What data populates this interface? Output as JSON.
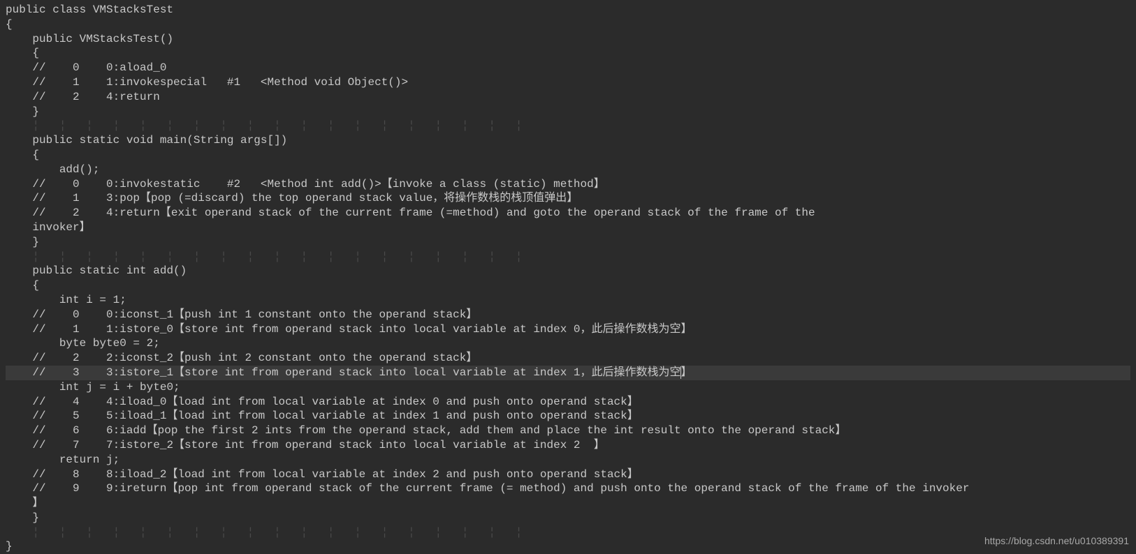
{
  "watermark": "https://blog.csdn.net/u010389391",
  "whitespace_guide": "    ¦   ¦   ¦   ¦   ¦   ¦   ¦   ¦   ¦   ¦   ¦   ¦   ¦   ¦   ¦   ¦   ¦   ¦   ¦",
  "code": {
    "line01": "public class VMStacksTest",
    "line02": "{",
    "line03": "    public VMStacksTest()",
    "line04": "    {",
    "line05": "    //    0    0:aload_0",
    "line06": "    //    1    1:invokespecial   #1   <Method void Object()>",
    "line07": "    //    2    4:return",
    "line08": "    }",
    "line10": "    public static void main(String args[])",
    "line11": "    {",
    "line12": "        add();",
    "line13": "    //    0    0:invokestatic    #2   <Method int add()>【invoke a class (static) method】",
    "line14": "    //    1    3:pop【pop (=discard) the top operand stack value，将操作数栈的栈顶值弹出】",
    "line15": "    //    2    4:return【exit operand stack of the current frame (=method) and goto the operand stack of the frame of the ",
    "line16": "    invoker】",
    "line17": "    }",
    "line19": "    public static int add()",
    "line20": "    {",
    "line21": "        int i = 1;",
    "line22": "    //    0    0:iconst_1【push int 1 constant onto the operand stack】",
    "line23": "    //    1    1:istore_0【store int from operand stack into local variable at index 0，此后操作数栈为空】",
    "line24": "        byte byte0 = 2;",
    "line25": "    //    2    2:iconst_2【push int 2 constant onto the operand stack】",
    "line26_a": "    //    3    3:istore_1【store int from operand stack into local variable at index 1，此后操作数栈为空",
    "line26_b": "】",
    "line27": "        int j = i + byte0;",
    "line28": "    //    4    4:iload_0【load int from local variable at index 0 and push onto operand stack】",
    "line29": "    //    5    5:iload_1【load int from local variable at index 1 and push onto operand stack】",
    "line30": "    //    6    6:iadd【pop the first 2 ints from the operand stack, add them and place the int result onto the operand stack】",
    "line31": "    //    7    7:istore_2【store int from operand stack into local variable at index 2  】",
    "line32": "        return j;",
    "line33": "    //    8    8:iload_2【load int from local variable at index 2 and push onto operand stack】",
    "line34": "    //    9    9:ireturn【pop int from operand stack of the current frame (= method) and push onto the operand stack of the frame of the invoker",
    "line35": "    】",
    "line36": "    }",
    "line38": "}"
  }
}
